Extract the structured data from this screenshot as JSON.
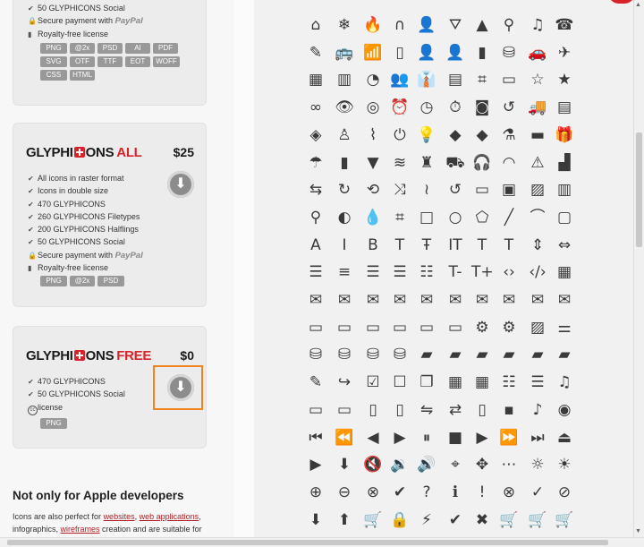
{
  "card_social": {
    "features": [
      {
        "icon": "check-icon",
        "text": "50 GLYPHICONS Social"
      },
      {
        "icon": "lock-icon",
        "text": "Secure payment with",
        "pay": "PayPal"
      },
      {
        "icon": "bookmark-icon",
        "text": "Royalty-free license"
      }
    ],
    "formats": [
      "PNG",
      "@2x",
      "PSD",
      "AI",
      "PDF",
      "SVG",
      "OTF",
      "TTF",
      "EOT",
      "WOFF",
      "CSS",
      "HTML"
    ]
  },
  "card_all": {
    "brand": "GLYPHICONS",
    "edition": "ALL",
    "price": "$25",
    "features": [
      {
        "icon": "check-icon",
        "text": "All icons in raster format"
      },
      {
        "icon": "check-icon",
        "text": "Icons in double size"
      },
      {
        "icon": "check-icon",
        "text": "470 GLYPHICONS"
      },
      {
        "icon": "check-icon",
        "text": "260 GLYPHICONS Filetypes"
      },
      {
        "icon": "check-icon",
        "text": "200 GLYPHICONS Halflings"
      },
      {
        "icon": "check-icon",
        "text": "50 GLYPHICONS Social"
      },
      {
        "icon": "lock-icon",
        "text": "Secure payment with",
        "pay": "PayPal"
      },
      {
        "icon": "bookmark-icon",
        "text": "Royalty-free license"
      }
    ],
    "formats": [
      "PNG",
      "@2x",
      "PSD"
    ]
  },
  "card_free": {
    "brand": "GLYPHICONS",
    "edition": "FREE",
    "price": "$0",
    "features": [
      {
        "icon": "check-icon",
        "text": "470 GLYPHICONS"
      },
      {
        "icon": "check-icon",
        "text": "50 GLYPHICONS Social"
      },
      {
        "icon": "cc-icon",
        "text": "license"
      }
    ],
    "formats": [
      "PNG"
    ]
  },
  "section": {
    "title": "Not only for Apple developers",
    "para_1": "Icons are also perfect for ",
    "link_websites": "websites",
    "para_2": ", ",
    "link_webapps": "web applications",
    "para_3": ",",
    "para_4": "infographics, ",
    "link_wireframes": "wireframes",
    "para_5": " creation and are suitable for"
  },
  "icon_grid": [
    [
      "home",
      "snowflake",
      "fire",
      "magnet",
      "user-add",
      "road",
      "road-2",
      "search",
      "music",
      "phone-list"
    ],
    [
      "pencil",
      "bus",
      "wifi",
      "iphone",
      "user",
      "user-2",
      "file",
      "database",
      "car",
      "plane"
    ],
    [
      "chart",
      "bar-chart",
      "pie",
      "group",
      "user-tie",
      "calendar",
      "router",
      "battery",
      "star-empty",
      "star"
    ],
    [
      "link",
      "eye-open",
      "eye-close",
      "alarm",
      "clock",
      "stopwatch",
      "projector",
      "history",
      "truck",
      "cargo"
    ],
    [
      "compass",
      "lamp",
      "paperclip",
      "power",
      "bulb",
      "tag",
      "tags",
      "cleaning",
      "ruler",
      "gift"
    ],
    [
      "umbrella",
      "book",
      "bookmark",
      "wifi-alt",
      "cup",
      "stroller",
      "headphones",
      "headset",
      "warning",
      "signal"
    ],
    [
      "retweet",
      "refresh",
      "roundabout",
      "shuffle",
      "wave",
      "repeat",
      "display",
      "app",
      "id-card",
      "building"
    ],
    [
      "eyedropper",
      "contrast",
      "drops",
      "crop",
      "vector-square",
      "vector-circle",
      "vector-polygon",
      "vector-line",
      "vector-curve",
      "vector-frame"
    ],
    [
      "font",
      "italic",
      "bold",
      "text-underline",
      "text-strike",
      "text-resize",
      "text-height",
      "text-frame",
      "text-space",
      "text-width"
    ],
    [
      "align-left",
      "align-center",
      "align-right",
      "justify",
      "list",
      "text-smaller",
      "text-bigger",
      "embed",
      "embed-close",
      "table"
    ],
    [
      "message-full",
      "message-empty",
      "message-in",
      "message-out",
      "message-plus",
      "message-minus",
      "message-ban",
      "message-flag",
      "message-lock",
      "message-new"
    ],
    [
      "inbox",
      "inbox-plus",
      "inbox-minus",
      "inbox-lock",
      "inbox-in",
      "inbox-out",
      "cog",
      "cogs",
      "picture",
      "adjust"
    ],
    [
      "database-lock",
      "database-plus",
      "database-minus",
      "database-ban",
      "folder-open",
      "folder-plus",
      "folder-minus",
      "folder-lock",
      "folder-flag",
      "folder-new"
    ],
    [
      "edit",
      "share",
      "check",
      "unchecked",
      "duplicate",
      "show-big-thumbnails",
      "show-thumbnails",
      "show-thumbnails-list",
      "show-list",
      "playlist"
    ],
    [
      "imac",
      "macbook",
      "ipad",
      "iphone-2",
      "iphone-transfer",
      "iphone-exchange",
      "ipod",
      "ipod-shuffle",
      "ear-plugs",
      "record"
    ],
    [
      "step-backward",
      "fast-backward",
      "rewind",
      "play",
      "pause",
      "stop",
      "forward",
      "fast-forward",
      "step-forward",
      "eject"
    ],
    [
      "facetime-video",
      "download-alt",
      "mute",
      "volume-down",
      "volume-up",
      "screenshot",
      "move",
      "more",
      "brightness-reduce",
      "brightness-increase"
    ],
    [
      "plus-sign",
      "minus-sign",
      "remove-sign",
      "ok-sign",
      "question-sign",
      "info-sign",
      "exclamation-sign",
      "remove-circle",
      "ok-circle",
      "ban-circle"
    ],
    [
      "download",
      "upload",
      "shopping-cart",
      "lock",
      "flash",
      "ok",
      "remove",
      "basket",
      "basket-out",
      "basket-in"
    ]
  ]
}
